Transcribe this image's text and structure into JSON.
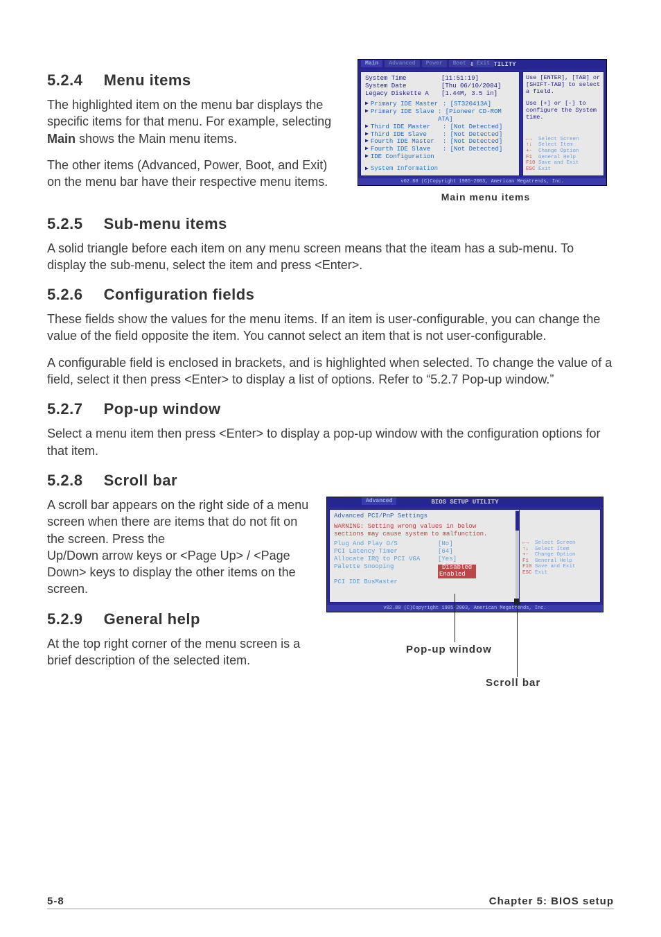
{
  "sections": {
    "s524_num": "5.2.4",
    "s524_title": "Menu items",
    "s524_p1a": "The highlighted item on the menu bar  displays the specific items for that menu. For example, selecting ",
    "s524_p1b": "Main",
    "s524_p1c": " shows the Main menu items.",
    "s524_p2": "The other items (Advanced, Power, Boot, and Exit) on the menu bar have their respective menu items.",
    "s525_num": "5.2.5",
    "s525_title": "Sub-menu items",
    "s525_p1": "A solid triangle before each item on any menu screen means that the iteam has a sub-menu. To display the sub-menu, select the item and press <Enter>.",
    "s526_num": "5.2.6",
    "s526_title": "Configuration fields",
    "s526_p1": "These fields show the values for the menu items. If an item is user-configurable, you can change the value of the field opposite the item. You cannot select an item that is not user-configurable.",
    "s526_p2": "A configurable field is enclosed in brackets, and is highlighted when selected. To change the value of a field, select it then press <Enter> to display a list of options. Refer to “5.2.7 Pop-up window.”",
    "s527_num": "5.2.7",
    "s527_title": "Pop-up window",
    "s527_p1": "Select a menu item then press <Enter> to display a pop-up window with the configuration options for that item.",
    "s528_num": "5.2.8",
    "s528_title": "Scroll bar",
    "s528_p1": "A scroll bar appears on the right side of a menu screen when there are items that do not fit on the screen. Press the",
    "s528_p2": "Up/Down arrow keys or <Page Up> / <Page Down> keys to display the other items on the screen.",
    "s529_num": "5.2.9",
    "s529_title": "General help",
    "s529_p1": "At the top right corner of the menu screen is a brief description of the selected item."
  },
  "bios1": {
    "header": "BIOS SETUP UTILITY",
    "tabs": [
      "Main",
      "Advanced",
      "Power",
      "Boot",
      "Exit"
    ],
    "rows": {
      "systime_k": "System Time",
      "systime_v": "[11:51:19]",
      "sysdate_k": "System Date",
      "sysdate_v": "[Thu 06/10/2004]",
      "legacy_k": "Legacy Diskette A",
      "legacy_v": "[1.44M, 3.5 in]",
      "pidem_k": "Primary IDE Master",
      "pidem_v": ": [ST320413A]",
      "pides_k": "Primary IDE Slave",
      "pides_v": ": [Pioneer CD-ROM ATA]",
      "tidem_k": "Third IDE Master",
      "tidem_v": ": [Not Detected]",
      "tides_k": "Third IDE Slave",
      "tides_v": ": [Not Detected]",
      "fidem_k": "Fourth IDE Master",
      "fidem_v": ": [Not Detected]",
      "fides_k": "Fourth IDE Slave",
      "fides_v": ": [Not Detected]",
      "idecfg": "IDE Configuration",
      "sysinfo": "System Information"
    },
    "help1": "Use [ENTER], [TAB] or [SHIFT-TAB] to select a field.",
    "help2": "Use [+] or [-] to configure the System time.",
    "nav": {
      "a_k": "←→",
      "a_v": "Select Screen",
      "b_k": "↑↓",
      "b_v": "Select Item",
      "c_k": "+-",
      "c_v": "Change Option",
      "d_k": "F1",
      "d_v": "General Help",
      "e_k": "F10",
      "e_v": "Save and Exit",
      "f_k": "ESC",
      "f_v": "Exit"
    },
    "footer": "v02.80 (C)Copyright 1985-2003, American Megatrends, Inc.",
    "caption": "Main menu items"
  },
  "bios2": {
    "header": "BIOS SETUP UTILITY",
    "tab": "Advanced",
    "title": "Advanced PCI/PnP Settings",
    "warn": "WARNING: Setting wrong values in below sections may cause system to malfunction.",
    "rows": {
      "pnp_k": "Plug And Play O/S",
      "pnp_v": "[No]",
      "lat_k": "PCI Latency Timer",
      "lat_v": "[64]",
      "irq_k": "Allocate IRQ to PCI VGA",
      "irq_v": "[Yes]",
      "pal_k": "Palette Snooping",
      "bus_k": "PCI IDE BusMaster"
    },
    "dropdown": {
      "a": "Disabled",
      "b": "Enabled"
    },
    "nav": {
      "a_k": "←→",
      "a_v": "Select Screen",
      "b_k": "↑↓",
      "b_v": "Select Item",
      "c_k": "+-",
      "c_v": "Change Option",
      "d_k": "F1",
      "d_v": "General Help",
      "e_k": "F10",
      "e_v": "Save and Exit",
      "f_k": "ESC",
      "f_v": "Exit"
    },
    "footer": "v02.80 (C)Copyright 1985-2003, American Megatrends, Inc.",
    "popup_label": "Pop-up window",
    "scroll_label": "Scroll bar"
  },
  "page_footer": {
    "left": "5-8",
    "right": "Chapter 5: BIOS setup"
  }
}
